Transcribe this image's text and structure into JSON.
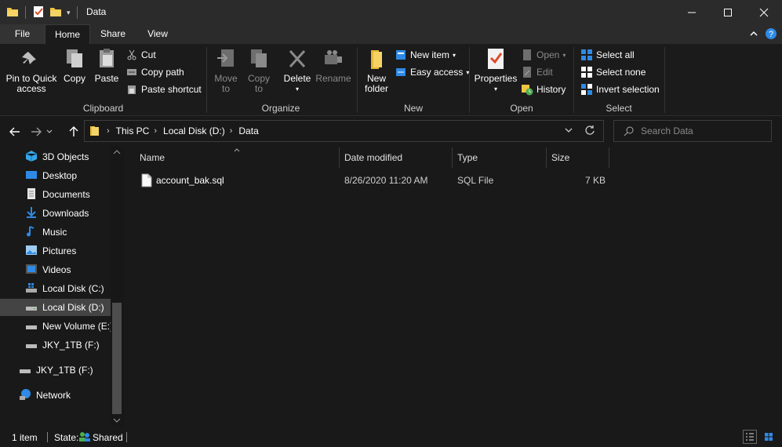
{
  "window": {
    "title": "Data",
    "controls": {
      "minimize": "—",
      "maximize": "☐",
      "close": "✕"
    }
  },
  "menubar": {
    "tabs": [
      {
        "label": "File"
      },
      {
        "label": "Home"
      },
      {
        "label": "Share"
      },
      {
        "label": "View"
      }
    ]
  },
  "ribbon": {
    "clipboard": {
      "label": "Clipboard",
      "pin_line1": "Pin to Quick",
      "pin_line2": "access",
      "copy": "Copy",
      "paste": "Paste",
      "cut": "Cut",
      "copy_path": "Copy path",
      "paste_shortcut": "Paste shortcut"
    },
    "organize": {
      "label": "Organize",
      "move_line1": "Move",
      "move_line2": "to",
      "copy_line1": "Copy",
      "copy_line2": "to",
      "delete": "Delete",
      "rename": "Rename"
    },
    "new": {
      "label": "New",
      "folder_line1": "New",
      "folder_line2": "folder",
      "new_item": "New item",
      "easy_access": "Easy access"
    },
    "open": {
      "label": "Open",
      "properties": "Properties",
      "open": "Open",
      "edit": "Edit",
      "history": "History"
    },
    "select": {
      "label": "Select",
      "select_all": "Select all",
      "select_none": "Select none",
      "invert": "Invert selection"
    }
  },
  "address": {
    "crumbs": [
      "This PC",
      "Local Disk (D:)",
      "Data"
    ],
    "search_placeholder": "Search Data"
  },
  "navpane": {
    "items": [
      {
        "label": "3D Objects"
      },
      {
        "label": "Desktop"
      },
      {
        "label": "Documents"
      },
      {
        "label": "Downloads"
      },
      {
        "label": "Music"
      },
      {
        "label": "Pictures"
      },
      {
        "label": "Videos"
      },
      {
        "label": "Local Disk (C:)"
      },
      {
        "label": "Local Disk (D:)"
      },
      {
        "label": "New Volume (E:)"
      },
      {
        "label": "JKY_1TB (F:)"
      },
      {
        "label": "JKY_1TB (F:)"
      },
      {
        "label": "Network"
      }
    ]
  },
  "filelist": {
    "columns": [
      "Name",
      "Date modified",
      "Type",
      "Size"
    ],
    "rows": [
      {
        "name": "account_bak.sql",
        "date": "8/26/2020 11:20 AM",
        "type": "SQL File",
        "size": "7 KB"
      }
    ]
  },
  "status": {
    "count": "1 item",
    "state_label": "State:",
    "state_value": "Shared"
  },
  "colors": {
    "background": "#191919",
    "titlebar": "#2b2b2b",
    "folder_yellow": "#f0c340",
    "accent_blue": "#2e8ae6"
  }
}
